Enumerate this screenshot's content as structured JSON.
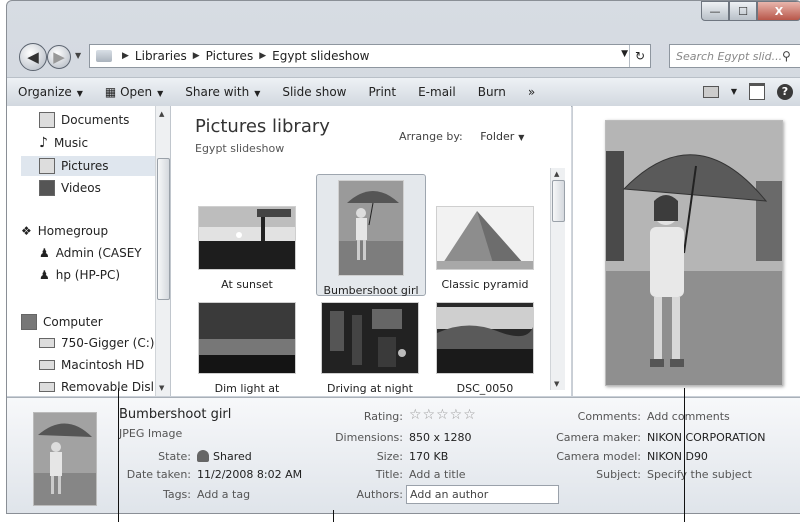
{
  "window": {
    "caption": {
      "minimize": "—",
      "maximize": "☐",
      "close": "X"
    }
  },
  "address": {
    "crumbs": [
      "Libraries",
      "Pictures",
      "Egypt slideshow"
    ],
    "search_placeholder": "Search Egypt slid..."
  },
  "toolbar": {
    "organize": "Organize",
    "open": "Open",
    "share_with": "Share with",
    "slide_show": "Slide show",
    "print": "Print",
    "email": "E-mail",
    "burn": "Burn",
    "more": "»"
  },
  "nav": {
    "documents": "Documents",
    "music": "Music",
    "pictures": "Pictures",
    "videos": "Videos",
    "homegroup": "Homegroup",
    "admin": "Admin (CASEY",
    "hp": "hp (HP-PC)",
    "computer": "Computer",
    "drive_c": "750-Gigger (C:)",
    "macintosh": "Macintosh HD",
    "removable": "Removable Disl"
  },
  "library": {
    "title": "Pictures library",
    "subtitle": "Egypt slideshow",
    "arrange_label": "Arrange by:",
    "arrange_value": "Folder"
  },
  "thumbnails": [
    {
      "caption": "At sunset"
    },
    {
      "caption": "Bumbershoot girl"
    },
    {
      "caption": "Classic pyramid"
    },
    {
      "caption": "Dim light at"
    },
    {
      "caption": "Driving at night"
    },
    {
      "caption": "DSC_0050"
    }
  ],
  "details": {
    "name": "Bumbershoot girl",
    "type": "JPEG Image",
    "state_label": "State:",
    "state_value": "Shared",
    "date_label": "Date taken:",
    "date_value": "11/2/2008 8:02 AM",
    "tags_label": "Tags:",
    "tags_value": "Add a tag",
    "rating_label": "Rating:",
    "rating_stars": "☆☆☆☆☆",
    "dimensions_label": "Dimensions:",
    "dimensions_value": "850 x 1280",
    "size_label": "Size:",
    "size_value": "170 KB",
    "title_label": "Title:",
    "title_value": "Add a title",
    "authors_label": "Authors:",
    "authors_value": "Add an author",
    "comments_label": "Comments:",
    "comments_value": "Add comments",
    "maker_label": "Camera maker:",
    "maker_value": "NIKON CORPORATION",
    "model_label": "Camera model:",
    "model_value": "NIKON D90",
    "subject_label": "Subject:",
    "subject_value": "Specify the subject"
  }
}
